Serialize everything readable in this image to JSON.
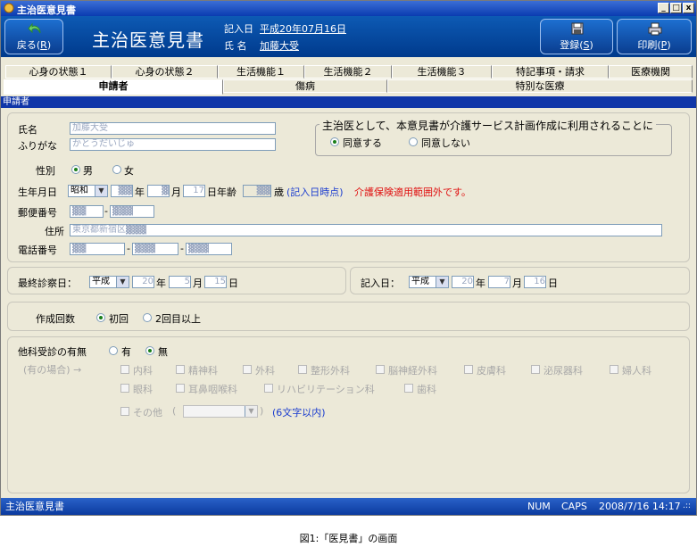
{
  "window": {
    "title": "主治医意見書",
    "min_btn": "_",
    "max_btn": "□",
    "close_btn": "x"
  },
  "header": {
    "back_label": "戻る(",
    "back_key": "R",
    "back_end": ")",
    "app_title": "主治医意見書",
    "date_label": "記入日",
    "date_value": "平成20年07月16日",
    "name_label": "氏 名",
    "name_value": "加藤大受",
    "register_label": "登録(",
    "register_key": "S",
    "print_label": "印刷(",
    "print_key": "P"
  },
  "tabs_row1": [
    "心身の状態１",
    "心身の状態２",
    "生活機能１",
    "生活機能２",
    "生活機能３",
    "特記事項・請求",
    "医療機関"
  ],
  "tabs_row2": [
    "申請者",
    "傷病",
    "特別な医療"
  ],
  "section_title": "申請者",
  "applicant": {
    "name_label": "氏名",
    "name_value": "加藤大受",
    "kana_label": "ふりがな",
    "kana_value": "かとうだいじゅ",
    "consent_legend": "主治医として、本意見書が介護サービス計画作成に利用されることに",
    "consent_yes": "同意する",
    "consent_no": "同意しない",
    "gender_label": "性別",
    "male": "男",
    "female": "女",
    "birth_label": "生年月日",
    "era_value": "昭和",
    "birth_year": "▓▓",
    "year_label": "年",
    "birth_month": "▓",
    "month_label": "月",
    "birth_day": "17",
    "day_age_label": "日年齢",
    "age_value": "▓▓",
    "age_unit": "歳",
    "age_note": "(記入日時点)",
    "age_warning": "介護保険適用範囲外です。",
    "postal_label": "郵便番号",
    "postal1": "▓▓",
    "postal2": "▓▓▓",
    "address_label": "住所",
    "address_value": "東京都新宿区▓▓▓",
    "phone_label": "電話番号",
    "phone1": "▓▓",
    "phone2": "▓▓▓",
    "phone3": "▓▓▓"
  },
  "exam": {
    "last_label": "最終診察日：",
    "last_era": "平成",
    "last_year": "20",
    "year_label": "年",
    "last_month": "5",
    "month_label": "月",
    "last_day": "15",
    "day_label": "日",
    "write_label": "記入日：",
    "write_era": "平成",
    "write_year": "20",
    "write_month": "7",
    "write_day": "16"
  },
  "count": {
    "label": "作成回数",
    "first": "初回",
    "second": "2回目以上"
  },
  "other_dept": {
    "label": "他科受診の有無",
    "yes": "有",
    "no": "無",
    "note": "(有の場合) →",
    "depts_row1": [
      "内科",
      "精神科",
      "外科",
      "整形外科",
      "脳神経外科",
      "皮膚科",
      "泌尿器科",
      "婦人科"
    ],
    "depts_row2": [
      "眼科",
      "耳鼻咽喉科",
      "リハビリテーション科",
      "歯科"
    ],
    "other_label": "その他",
    "paren_open": "(",
    "paren_close": ")",
    "limit_note": "(6文字以内)"
  },
  "status": {
    "app": "主治医意見書",
    "num": "NUM",
    "caps": "CAPS",
    "datetime": "2008/7/16 14:17"
  },
  "caption": "図1:「医見書」の画面"
}
